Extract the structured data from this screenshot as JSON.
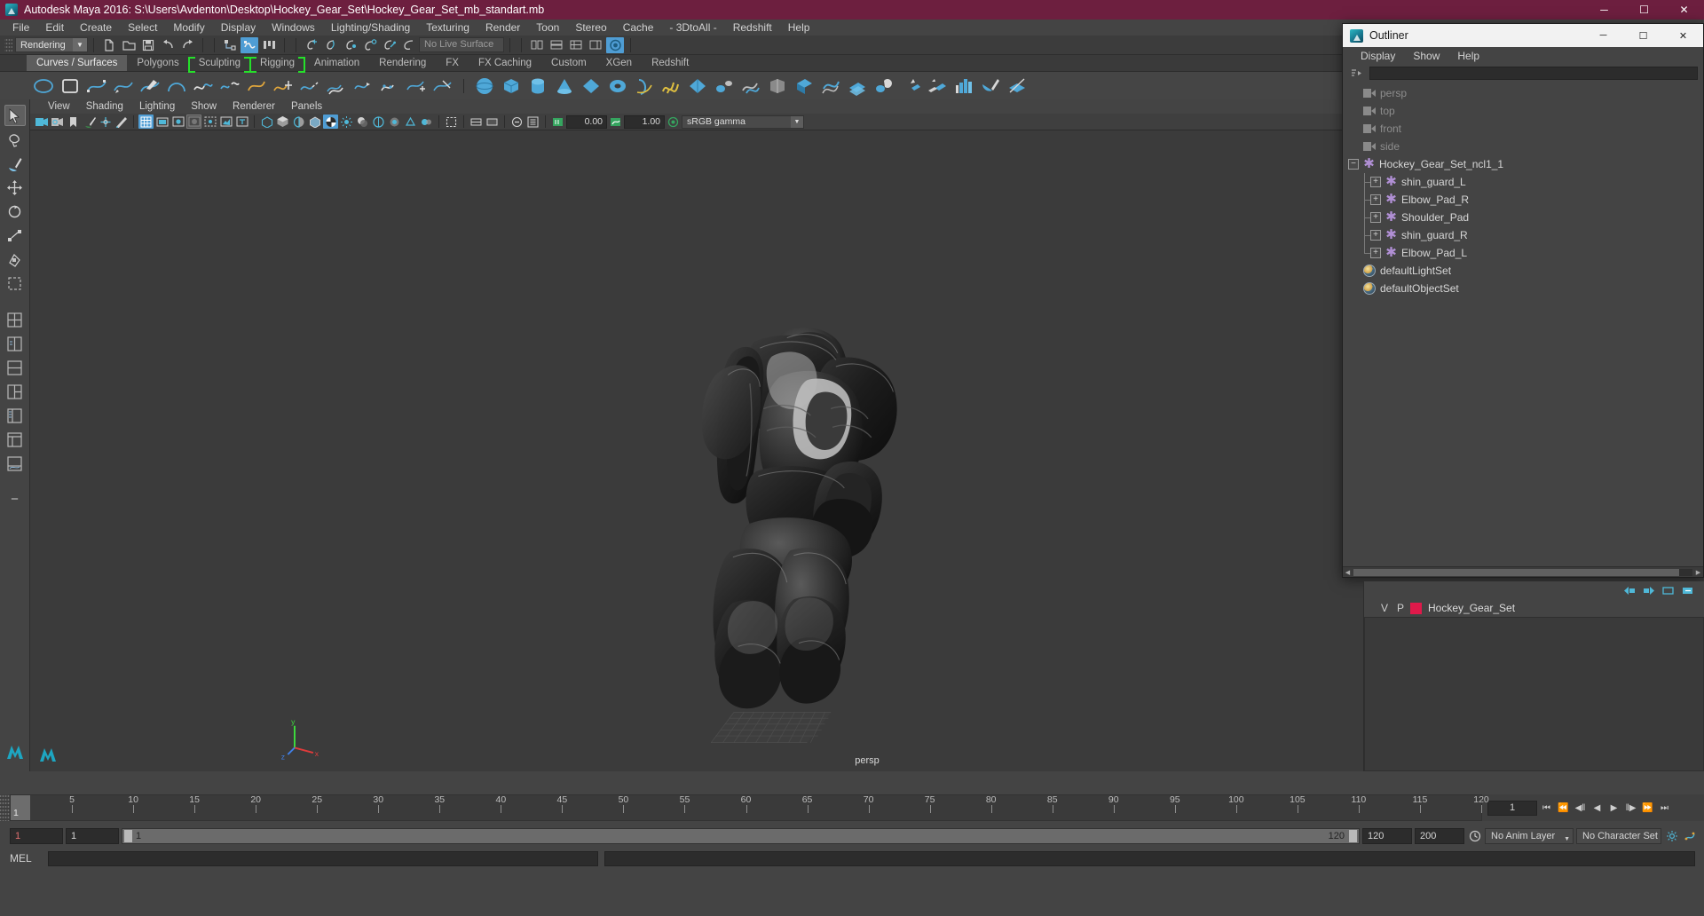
{
  "window": {
    "title": "Autodesk Maya 2016: S:\\Users\\Avdenton\\Desktop\\Hockey_Gear_Set\\Hockey_Gear_Set_mb_standart.mb",
    "minimize": "─",
    "maximize": "☐",
    "close": "✕"
  },
  "menubar": {
    "items": [
      "File",
      "Edit",
      "Create",
      "Select",
      "Modify",
      "Display",
      "Windows",
      "Lighting/Shading",
      "Texturing",
      "Render",
      "Toon",
      "Stereo",
      "Cache",
      "- 3DtoAll -",
      "Redshift",
      "Help"
    ]
  },
  "statusline": {
    "mode": "Rendering",
    "live_surface": "No Live Surface"
  },
  "shelf": {
    "tabs": [
      {
        "label": "Curves / Surfaces",
        "active": true,
        "bracket": false
      },
      {
        "label": "Polygons",
        "active": false,
        "bracket": false
      },
      {
        "label": "Sculpting",
        "active": false,
        "bracket": true
      },
      {
        "label": "Rigging",
        "active": false,
        "bracket": true
      },
      {
        "label": "Animation",
        "active": false,
        "bracket": false
      },
      {
        "label": "Rendering",
        "active": false,
        "bracket": false
      },
      {
        "label": "FX",
        "active": false,
        "bracket": false
      },
      {
        "label": "FX Caching",
        "active": false,
        "bracket": false
      },
      {
        "label": "Custom",
        "active": false,
        "bracket": false
      },
      {
        "label": "XGen",
        "active": false,
        "bracket": false
      },
      {
        "label": "Redshift",
        "active": false,
        "bracket": false
      }
    ]
  },
  "viewport": {
    "menus": [
      "View",
      "Shading",
      "Lighting",
      "Show",
      "Renderer",
      "Panels"
    ],
    "exposure": "0.00",
    "gamma": "1.00",
    "colorspace": "sRGB gamma",
    "camera_label": "persp"
  },
  "outliner": {
    "title": "Outliner",
    "menus": [
      "Display",
      "Show",
      "Help"
    ],
    "minimize": "─",
    "maximize": "☐",
    "close": "✕",
    "items": [
      {
        "label": "persp",
        "type": "camera",
        "depth": 0,
        "dim": true
      },
      {
        "label": "top",
        "type": "camera",
        "depth": 0,
        "dim": true
      },
      {
        "label": "front",
        "type": "camera",
        "depth": 0,
        "dim": true
      },
      {
        "label": "side",
        "type": "camera",
        "depth": 0,
        "dim": true
      },
      {
        "label": "Hockey_Gear_Set_ncl1_1",
        "type": "node",
        "depth": 0,
        "dim": false,
        "expander": "−"
      },
      {
        "label": "shin_guard_L",
        "type": "node",
        "depth": 1,
        "dim": false,
        "expander": "+"
      },
      {
        "label": "Elbow_Pad_R",
        "type": "node",
        "depth": 1,
        "dim": false,
        "expander": "+"
      },
      {
        "label": "Shoulder_Pad",
        "type": "node",
        "depth": 1,
        "dim": false,
        "expander": "+"
      },
      {
        "label": "shin_guard_R",
        "type": "node",
        "depth": 1,
        "dim": false,
        "expander": "+"
      },
      {
        "label": "Elbow_Pad_L",
        "type": "node",
        "depth": 1,
        "dim": false,
        "expander": "+",
        "last": true
      },
      {
        "label": "defaultLightSet",
        "type": "set",
        "depth": 0,
        "dim": false
      },
      {
        "label": "defaultObjectSet",
        "type": "set",
        "depth": 0,
        "dim": false
      }
    ]
  },
  "layers": {
    "col_v": "V",
    "col_p": "P",
    "color": "#e0194a",
    "name": "Hockey_Gear_Set"
  },
  "timeline": {
    "current_frame": "1",
    "ticks": [
      5,
      10,
      15,
      20,
      25,
      30,
      35,
      40,
      45,
      50,
      55,
      60,
      65,
      70,
      75,
      80,
      85,
      90,
      95,
      100,
      105,
      110,
      115,
      120
    ],
    "frame_field": "1",
    "playback": {
      "go_start": "⏮",
      "step_back_key": "⏪",
      "step_back": "◀‖",
      "play_back": "◀",
      "play": "▶",
      "step_fwd": "‖▶",
      "step_fwd_key": "⏩",
      "go_end": "⏭"
    }
  },
  "range": {
    "anim_start": "1",
    "range_start": "1",
    "slider_left": "1",
    "slider_right": "120",
    "range_end": "120",
    "anim_end": "200",
    "anim_layer": "No Anim Layer",
    "character_set": "No Character Set"
  },
  "command": {
    "label": "MEL",
    "input": "",
    "output": ""
  }
}
